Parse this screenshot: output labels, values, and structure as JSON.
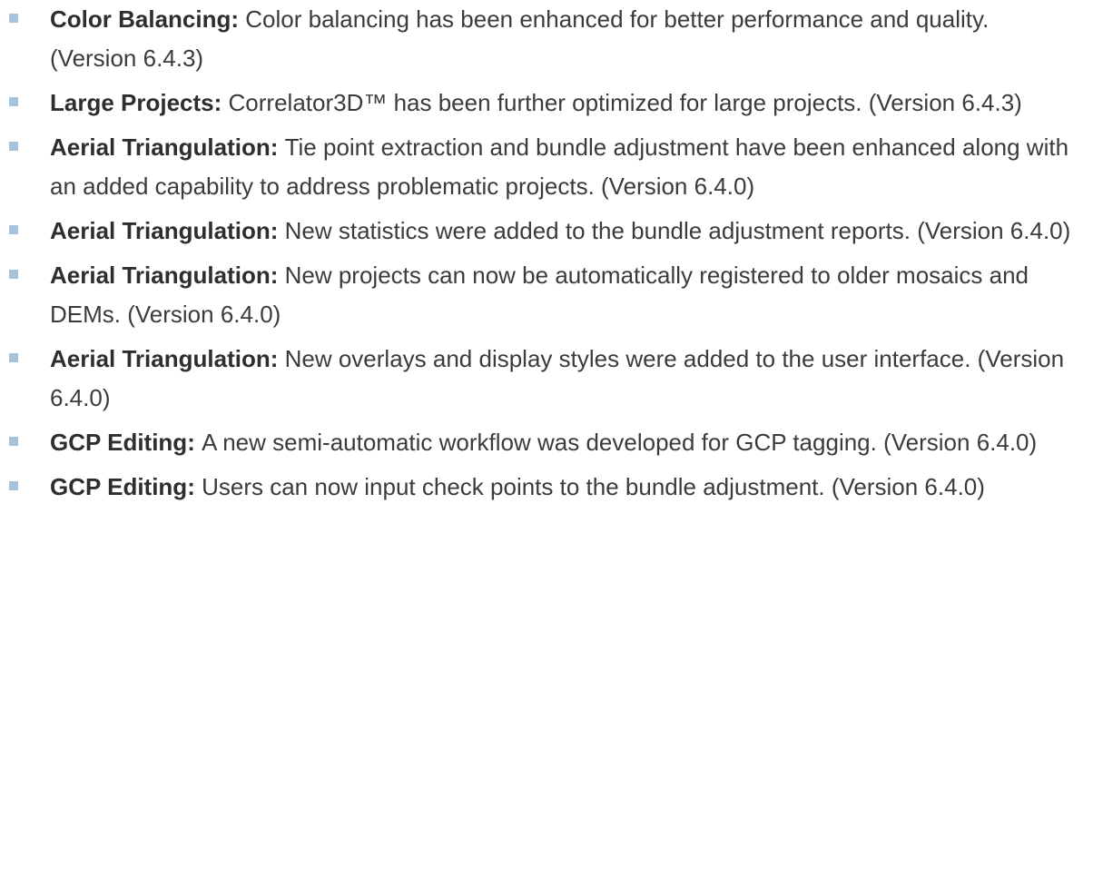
{
  "items": [
    {
      "lead": "Color Balancing:",
      "text": "Color balancing has been enhanced for better performance and quality. (Version 6.4.3)"
    },
    {
      "lead": "Large Projects:",
      "text": "Correlator3D™ has been further optimized for large projects. (Version 6.4.3)"
    },
    {
      "lead": "Aerial Triangulation:",
      "text": "Tie point extraction and bundle adjustment have been enhanced along with an added capability to address problematic projects. (Version 6.4.0)"
    },
    {
      "lead": "Aerial Triangulation:",
      "text": "New statistics were added to the bundle adjustment reports. (Version 6.4.0)"
    },
    {
      "lead": "Aerial Triangulation:",
      "text": "New projects can now be automatically registered to older mosaics and DEMs. (Version 6.4.0)"
    },
    {
      "lead": "Aerial Triangulation:",
      "text": "New overlays and display styles were added to the user interface. (Version 6.4.0)"
    },
    {
      "lead": "GCP Editing:",
      "text": "A new semi-automatic workflow was developed for GCP tagging. (Version 6.4.0)"
    },
    {
      "lead": "GCP Editing:",
      "text": "Users can now input check points to the bundle adjustment. (Version 6.4.0)"
    }
  ],
  "colors": {
    "bullet": "#a7c2db",
    "text": "#3b3b3b"
  }
}
